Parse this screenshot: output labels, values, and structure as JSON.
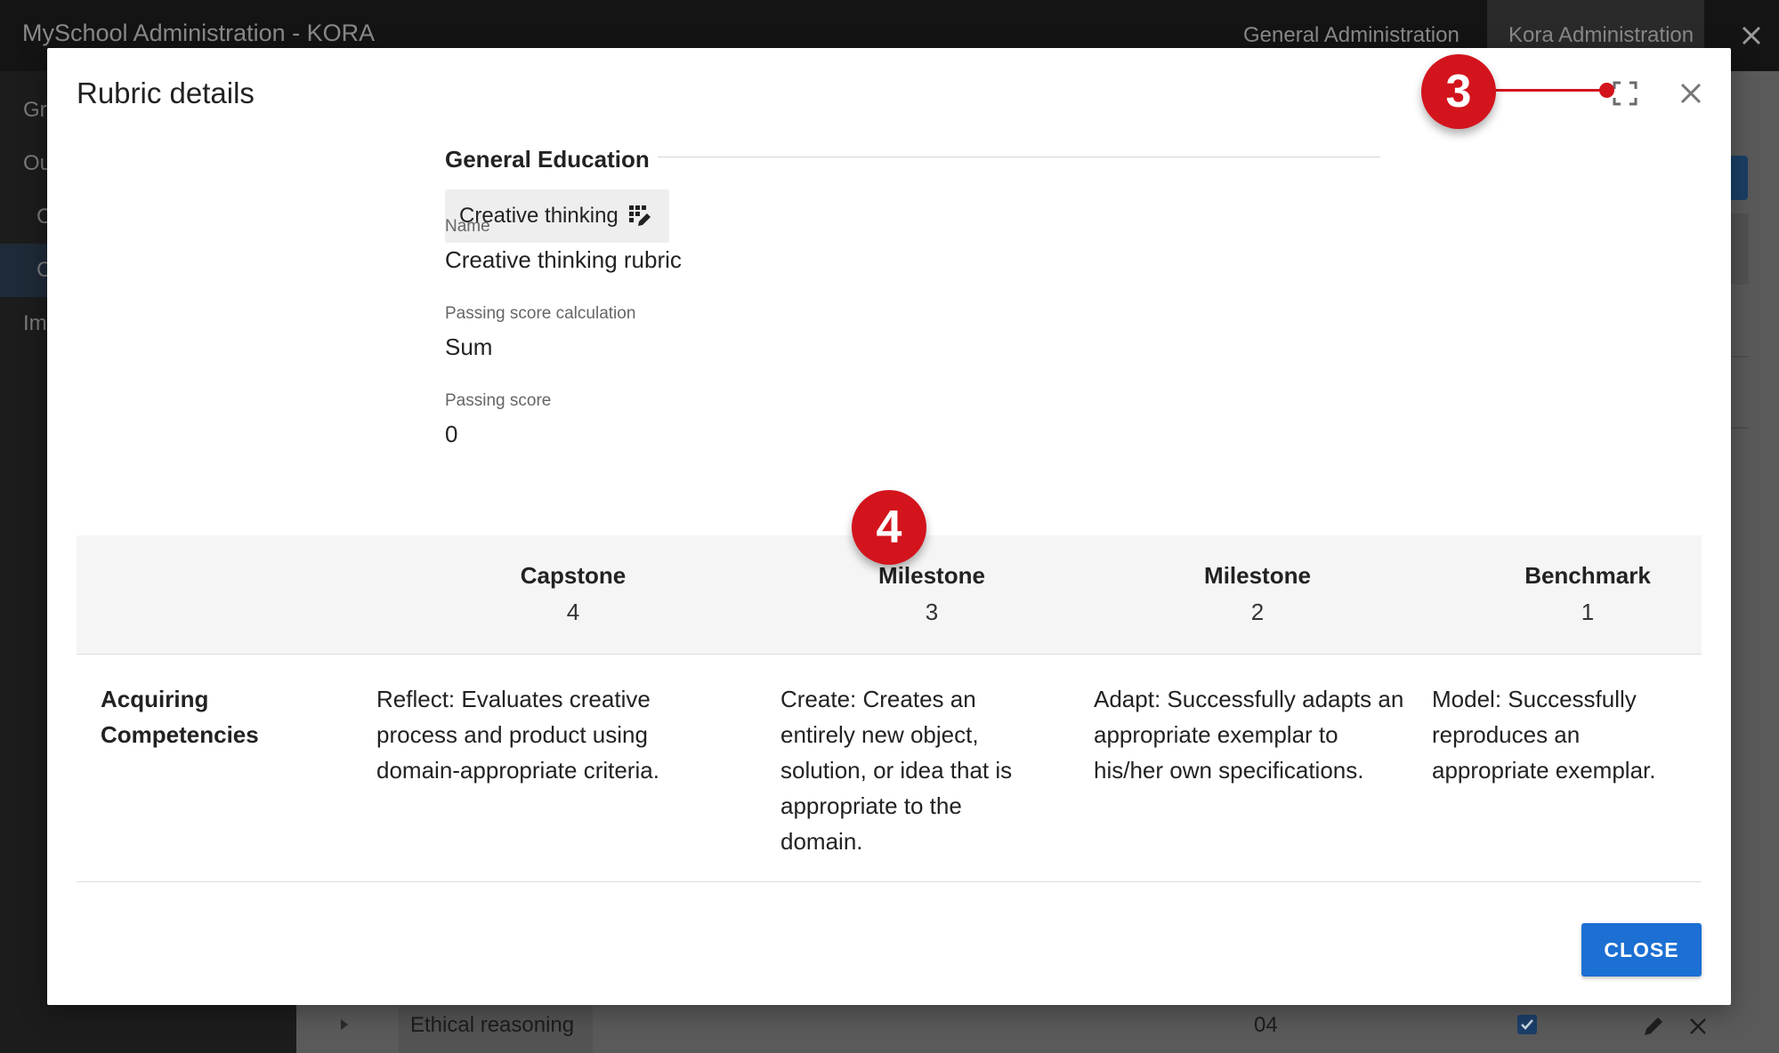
{
  "app": {
    "title": "MySchool Administration - KORA",
    "tabs": [
      {
        "label": "General Administration"
      },
      {
        "label": "Kora Administration"
      }
    ]
  },
  "sidebar": {
    "items": [
      {
        "label": "Gr"
      },
      {
        "label": "Ou"
      },
      {
        "label": "C"
      },
      {
        "label": "C"
      },
      {
        "label": "Im"
      }
    ]
  },
  "background_row": {
    "label": "Ethical reasoning",
    "number": "04"
  },
  "modal": {
    "title": "Rubric details",
    "section_heading": "General Education",
    "chip_label": "Creative thinking",
    "fields": [
      {
        "label": "Name",
        "value": "Creative thinking rubric"
      },
      {
        "label": "Passing score calculation",
        "value": "Sum"
      },
      {
        "label": "Passing score",
        "value": "0"
      }
    ],
    "levels": [
      {
        "name": "Capstone",
        "score": "4"
      },
      {
        "name": "Milestone",
        "score": "3"
      },
      {
        "name": "Milestone",
        "score": "2"
      },
      {
        "name": "Benchmark",
        "score": "1"
      }
    ],
    "criteria": [
      {
        "name": "Acquiring Competencies",
        "cells": [
          "Reflect: Evaluates creative process and product using domain-appropriate criteria.",
          "Create: Creates an entirely new object, solution, or idea that is appropriate to the domain.",
          "Adapt: Successfully adapts an appropriate exemplar to his/her own specifications.",
          "Model: Successfully reproduces an appropriate exemplar."
        ]
      }
    ],
    "close_label": "CLOSE"
  },
  "callouts": {
    "expand": "3",
    "levels": "4"
  },
  "colors": {
    "accent": "#1c6fd3",
    "callout": "#d3141d"
  }
}
